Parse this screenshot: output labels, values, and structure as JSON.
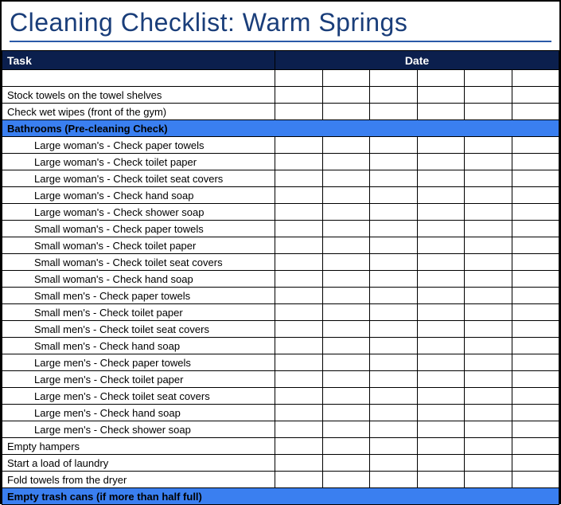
{
  "title": "Cleaning Checklist: Warm Springs",
  "headers": {
    "task": "Task",
    "date": "Date"
  },
  "rows": [
    {
      "type": "blank",
      "text": ""
    },
    {
      "type": "task",
      "text": "Stock towels on the towel shelves"
    },
    {
      "type": "task",
      "text": "Check wet wipes (front of the gym)"
    },
    {
      "type": "section",
      "text": "Bathrooms (Pre-cleaning Check)"
    },
    {
      "type": "subtask",
      "text": "Large woman's - Check paper towels"
    },
    {
      "type": "subtask",
      "text": "Large woman's - Check toilet paper"
    },
    {
      "type": "subtask",
      "text": "Large woman's - Check toilet seat covers"
    },
    {
      "type": "subtask",
      "text": "Large woman's - Check hand soap"
    },
    {
      "type": "subtask",
      "text": "Large woman's - Check shower soap"
    },
    {
      "type": "subtask",
      "text": "Small woman's - Check paper towels"
    },
    {
      "type": "subtask",
      "text": "Small woman's - Check toilet paper"
    },
    {
      "type": "subtask",
      "text": "Small woman's - Check toilet seat covers"
    },
    {
      "type": "subtask",
      "text": "Small woman's - Check hand soap"
    },
    {
      "type": "subtask",
      "text": "Small men's - Check paper towels"
    },
    {
      "type": "subtask",
      "text": "Small men's - Check toilet paper"
    },
    {
      "type": "subtask",
      "text": "Small men's - Check toilet seat covers"
    },
    {
      "type": "subtask",
      "text": "Small men's - Check hand soap"
    },
    {
      "type": "subtask",
      "text": "Large men's - Check paper towels"
    },
    {
      "type": "subtask",
      "text": "Large men's - Check toilet paper"
    },
    {
      "type": "subtask",
      "text": "Large men's - Check toilet seat covers"
    },
    {
      "type": "subtask",
      "text": "Large men's - Check hand soap"
    },
    {
      "type": "subtask",
      "text": "Large men's - Check shower soap"
    },
    {
      "type": "task",
      "text": "Empty hampers"
    },
    {
      "type": "task",
      "text": "Start a load of laundry"
    },
    {
      "type": "task",
      "text": "Fold towels from the dryer"
    },
    {
      "type": "section",
      "text": "Empty trash cans (if more than half full)"
    }
  ],
  "date_columns": 6
}
